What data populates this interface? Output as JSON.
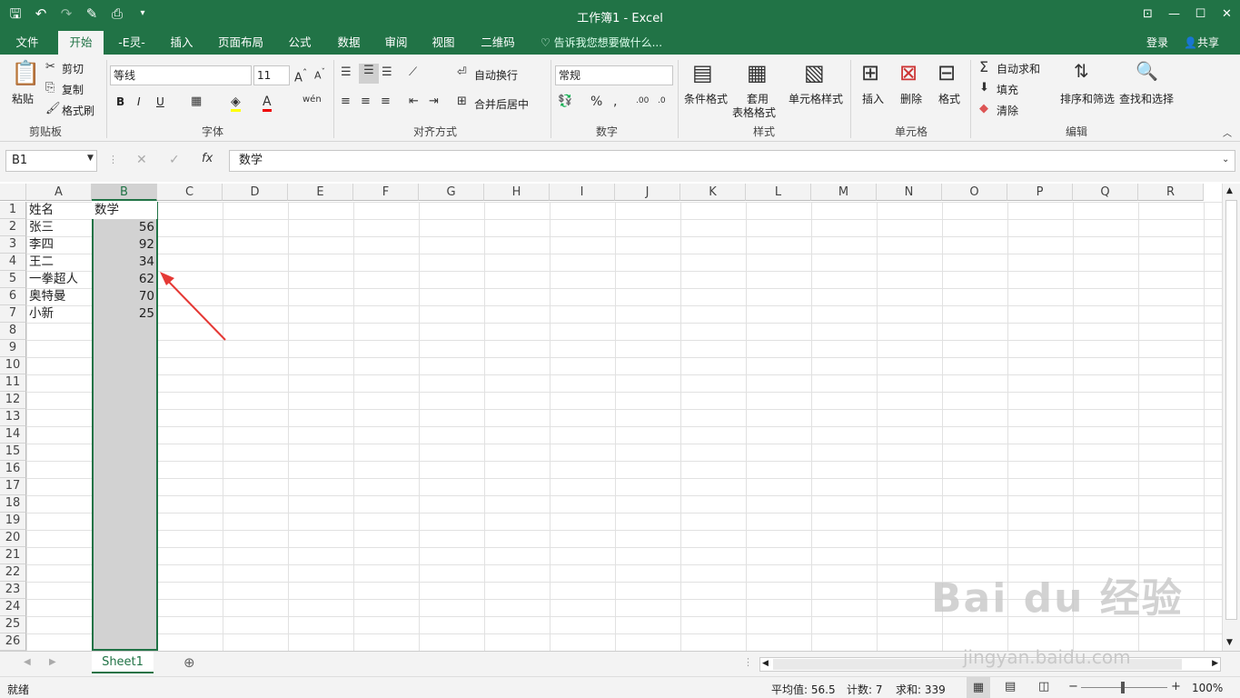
{
  "title": "工作簿1 - Excel",
  "tabs": [
    "文件",
    "开始",
    "-E灵-",
    "插入",
    "页面布局",
    "公式",
    "数据",
    "审阅",
    "视图",
    "二维码"
  ],
  "tell_me": "告诉我您想要做什么...",
  "account": {
    "login": "登录",
    "share": "共享"
  },
  "clipboard": {
    "paste": "粘贴",
    "cut": "剪切",
    "copy": "复制",
    "format_painter": "格式刷",
    "label": "剪贴板"
  },
  "font": {
    "name": "等线",
    "size": "11",
    "bold": "B",
    "italic": "I",
    "underline": "U",
    "label": "字体"
  },
  "alignment": {
    "wrap": "自动换行",
    "merge": "合并后居中",
    "label": "对齐方式"
  },
  "number": {
    "format": "常规",
    "label": "数字"
  },
  "styles": {
    "conditional": "条件格式",
    "table1": "套用",
    "table2": "表格格式",
    "cell_styles": "单元格样式",
    "label": "样式"
  },
  "cells": {
    "insert": "插入",
    "delete": "删除",
    "format": "格式",
    "label": "单元格"
  },
  "editing": {
    "autosum": "自动求和",
    "fill": "填充",
    "clear": "清除",
    "sort": "排序和筛选",
    "find": "查找和选择",
    "label": "编辑"
  },
  "name_box": "B1",
  "formula": "数学",
  "columns": [
    "A",
    "B",
    "C",
    "D",
    "E",
    "F",
    "G",
    "H",
    "I",
    "J",
    "K",
    "L",
    "M",
    "N",
    "O",
    "P",
    "Q",
    "R"
  ],
  "rows": [
    "1",
    "2",
    "3",
    "4",
    "5",
    "6",
    "7",
    "8",
    "9",
    "10",
    "11",
    "12",
    "13",
    "14",
    "15",
    "16",
    "17",
    "18",
    "19",
    "20",
    "21",
    "22",
    "23",
    "24",
    "25",
    "26"
  ],
  "data": {
    "a": [
      "姓名",
      "张三",
      "李四",
      "王二",
      "一拳超人",
      "奥特曼",
      "小新"
    ],
    "b": [
      "数学",
      "56",
      "92",
      "34",
      "62",
      "70",
      "25"
    ]
  },
  "sheet": "Sheet1",
  "status": {
    "ready": "就绪",
    "average": "平均值: 56.5",
    "count": "计数: 7",
    "sum": "求和: 339",
    "zoom": "100%"
  },
  "watermark": {
    "logo": "Bai du 经验",
    "url": "jingyan.baidu.com"
  },
  "colors": {
    "accent": "#217346",
    "arrow": "#e53935"
  }
}
